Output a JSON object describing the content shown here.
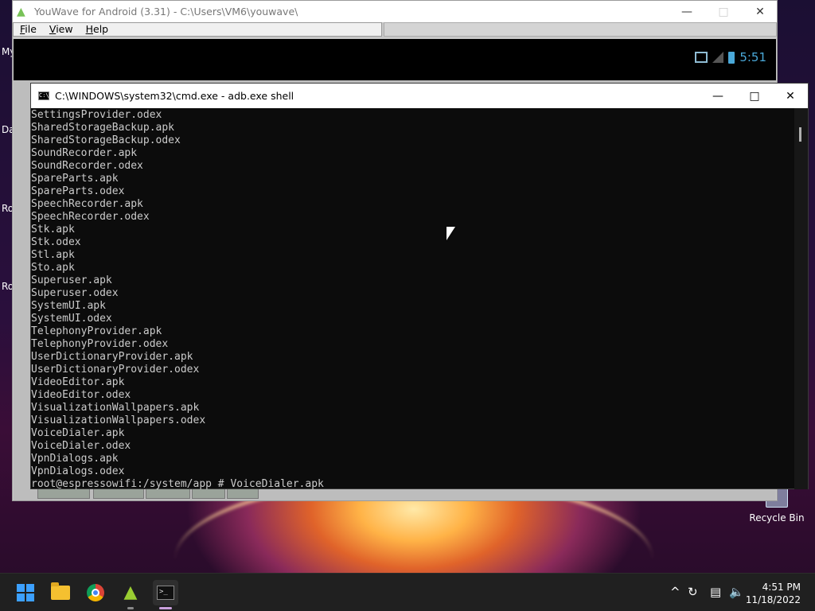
{
  "desktop": {
    "side_letters": [
      "My",
      "Da",
      "Ro",
      "Ro"
    ],
    "recycle_bin_label": "Recycle Bin"
  },
  "youwave": {
    "title": "YouWave for Android (3.31) - C:\\Users\\VM6\\youwave\\",
    "menu": [
      "File",
      "View",
      "Help"
    ],
    "android_status_time": "5:51"
  },
  "cmd": {
    "title": "C:\\WINDOWS\\system32\\cmd.exe - adb.exe  shell",
    "lines": [
      "SettingsProvider.odex",
      "SharedStorageBackup.apk",
      "SharedStorageBackup.odex",
      "SoundRecorder.apk",
      "SoundRecorder.odex",
      "SpareParts.apk",
      "SpareParts.odex",
      "SpeechRecorder.apk",
      "SpeechRecorder.odex",
      "Stk.apk",
      "Stk.odex",
      "Stl.apk",
      "Sto.apk",
      "Superuser.apk",
      "Superuser.odex",
      "SystemUI.apk",
      "SystemUI.odex",
      "TelephonyProvider.apk",
      "TelephonyProvider.odex",
      "UserDictionaryProvider.apk",
      "UserDictionaryProvider.odex",
      "VideoEditor.apk",
      "VideoEditor.odex",
      "VisualizationWallpapers.apk",
      "VisualizationWallpapers.odex",
      "VoiceDialer.apk",
      "VoiceDialer.odex",
      "VpnDialogs.apk",
      "VpnDialogs.odex",
      "root@espressowifi:/system/app # VoiceDialer.apk"
    ]
  },
  "taskbar": {
    "time": "4:51 PM",
    "date": "11/18/2022",
    "tray_chevron": "^"
  },
  "icons": {
    "android": "android-icon",
    "cmd": "terminal-icon",
    "start": "windows-logo-icon",
    "explorer": "folder-icon",
    "chrome": "chrome-icon"
  },
  "colors": {
    "console_bg": "#0c0c0c",
    "console_fg": "#cccccc",
    "taskbar_bg": "#202020",
    "android_status": "#4aa8d8"
  }
}
